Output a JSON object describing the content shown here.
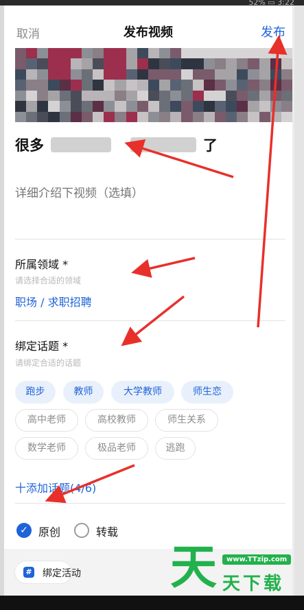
{
  "status_bar": {
    "right_text": "52% ▭ 3:22"
  },
  "header": {
    "cancel_label": "取消",
    "title": "发布视频",
    "publish_label": "发布"
  },
  "video": {
    "title_prefix": "很多",
    "title_suffix": "了"
  },
  "description": {
    "placeholder": "详细介绍下视频（选填）"
  },
  "domain_section": {
    "label": "所属领域 *",
    "hint": "请选择合适的领域",
    "value": "职场 / 求职招聘"
  },
  "topic_section": {
    "label": "绑定话题 *",
    "hint": "请绑定合适的话题",
    "selected_tags": [
      "跑步",
      "教师",
      "大学教师",
      "师生恋"
    ],
    "suggested_tags": [
      "高中老师",
      "高校教师",
      "师生关系",
      "数学老师",
      "极品老师",
      "逃跑"
    ],
    "add_topic_label": "十添加话题(4/6)"
  },
  "originality": {
    "options": [
      {
        "label": "原创",
        "checked": true
      },
      {
        "label": "转载",
        "checked": false
      }
    ]
  },
  "activity": {
    "label": "绑定活动",
    "icon_glyph": "#"
  },
  "watermark": {
    "big": "天",
    "url": "www.TTzip.com",
    "small": "天下载"
  },
  "colors": {
    "accent": "#1f63d8",
    "brand_green": "#22b14c",
    "annotation_red": "#e8302a"
  }
}
